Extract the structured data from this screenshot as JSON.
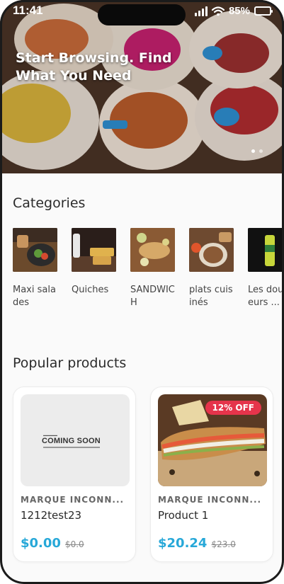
{
  "status_bar": {
    "time": "11:41",
    "battery": "85%",
    "battery_level": 0.85
  },
  "hero": {
    "title": "Start Browsing. Find What You Need",
    "slide_count": 2,
    "active_slide": 1
  },
  "categories": {
    "title": "Categories",
    "items": [
      {
        "label": "Maxi salades"
      },
      {
        "label": "Quiches"
      },
      {
        "label": "SANDWICH"
      },
      {
        "label": "plats cuisinés"
      },
      {
        "label": "Les douceurs ..."
      }
    ]
  },
  "popular": {
    "title": "Popular products",
    "products": [
      {
        "brand": "MARQUE INCONN...",
        "name": "1212test23",
        "price": "$0.00",
        "old_price": "$0.0",
        "image_text": "COMING SOON"
      },
      {
        "brand": "MARQUE INCONN...",
        "name": "Product 1",
        "price": "$20.24",
        "old_price": "$23.0",
        "discount": "12% OFF"
      }
    ]
  },
  "colors": {
    "price": "#27a8d8",
    "discount": "#e5344b",
    "battery": "#45d46b"
  }
}
